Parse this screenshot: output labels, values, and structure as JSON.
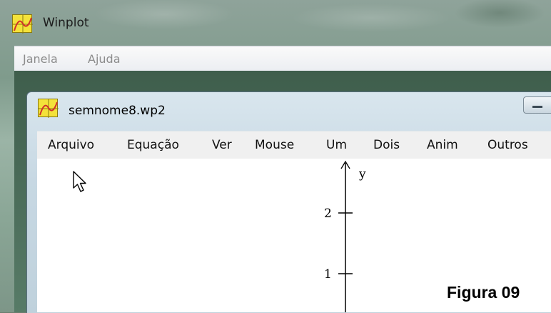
{
  "app": {
    "title": "Winplot",
    "menu": [
      "Janela",
      "Ajuda"
    ]
  },
  "document_window": {
    "title": "semnome8.wp2",
    "menu": [
      "Arquivo",
      "Equação",
      "Ver",
      "Mouse",
      "Um",
      "Dois",
      "Anim",
      "Outros"
    ]
  },
  "plot": {
    "y_axis_label": "y",
    "y_ticks": [
      "2",
      "1"
    ]
  },
  "caption": "Figura 09",
  "icons": [
    "winplot-app-icon",
    "winplot-document-icon",
    "mouse-pointer-icon",
    "minimize-icon"
  ],
  "colors": {
    "app_icon_fill": "#f4e23a",
    "app_icon_curve": "#d0302a",
    "plot_background": "#ffffff"
  }
}
